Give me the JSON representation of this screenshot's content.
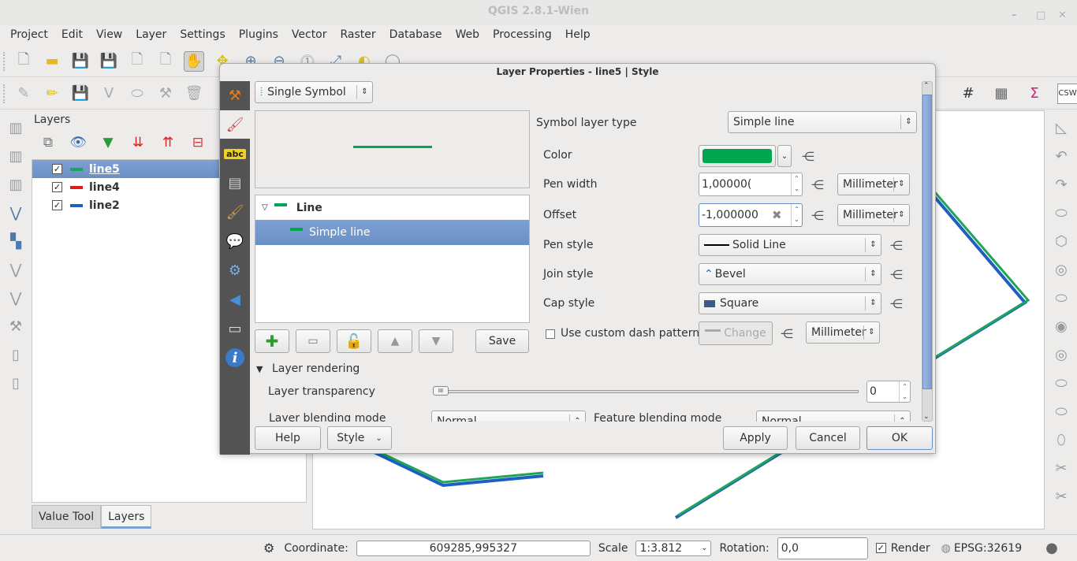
{
  "window": {
    "title": "QGIS 2.8.1-Wien",
    "controls": [
      "minimize",
      "maximize",
      "close"
    ]
  },
  "menubar": [
    "Project",
    "Edit",
    "View",
    "Layer",
    "Settings",
    "Plugins",
    "Vector",
    "Raster",
    "Database",
    "Web",
    "Processing",
    "Help"
  ],
  "toolbar1": [
    "new-project-icon",
    "open-project-icon",
    "save-project-icon",
    "save-as-icon",
    "new-composer-icon",
    "composer-manager-icon",
    "pan-icon",
    "pan-to-selection-icon",
    "zoom-in-icon",
    "zoom-out-icon",
    "zoom-native-icon",
    "zoom-full-icon",
    "zoom-to-selection-icon",
    "zoom-to-layer-icon",
    "zoom-last-icon",
    "zoom-next-icon",
    "refresh-icon"
  ],
  "toolbar2": [
    "current-edits-icon",
    "toggle-editing-icon",
    "save-edits-icon",
    "node-tool-icon",
    "move-feature-icon",
    "digitize-icon",
    "delete-selected-icon"
  ],
  "layers_panel": {
    "title": "Layers",
    "layers": [
      {
        "name": "line5",
        "checked": true,
        "color": "#1fa55a",
        "selected": true
      },
      {
        "name": "line4",
        "checked": true,
        "color": "#e31a1c",
        "selected": false
      },
      {
        "name": "line2",
        "checked": true,
        "color": "#1f5fbf",
        "selected": false
      }
    ],
    "tabs": [
      {
        "label": "Value Tool",
        "active": false
      },
      {
        "label": "Layers",
        "active": true
      }
    ]
  },
  "dialog": {
    "title": "Layer Properties - line5 | Style",
    "renderer": "Single Symbol",
    "sidebar": [
      "general-icon",
      "style-icon",
      "labels-icon",
      "fields-icon",
      "rendering-icon",
      "display-icon",
      "actions-icon",
      "joins-icon",
      "diagrams-icon",
      "metadata-icon"
    ],
    "tree": {
      "root": "Line",
      "child": "Simple line"
    },
    "save_label": "Save",
    "symbol_layer_type_label": "Symbol layer type",
    "symbol_layer_type": "Simple line",
    "color_label": "Color",
    "color_value": "#00a54f",
    "pen_width_label": "Pen width",
    "pen_width": "1,00000(",
    "pen_width_unit": "Millimeter",
    "offset_label": "Offset",
    "offset": "-1,000000",
    "offset_unit": "Millimeter",
    "pen_style_label": "Pen style",
    "pen_style": "Solid Line",
    "join_style_label": "Join style",
    "join_style": "Bevel",
    "cap_style_label": "Cap style",
    "cap_style": "Square",
    "custom_dash_label": "Use custom dash pattern",
    "custom_dash_checked": false,
    "change_label": "Change",
    "dash_unit": "Millimeter",
    "layer_rendering_label": "Layer rendering",
    "transparency_label": "Layer transparency",
    "transparency_value": "0",
    "layer_blending_label": "Layer blending mode",
    "layer_blending": "Normal",
    "feature_blending_label": "Feature blending mode",
    "feature_blending": "Normal",
    "help_label": "Help",
    "style_label": "Style",
    "apply_label": "Apply",
    "cancel_label": "Cancel",
    "ok_label": "OK"
  },
  "statusbar": {
    "coordinate_label": "Coordinate:",
    "coordinate": "609285,995327",
    "scale_label": "Scale",
    "scale": "1:3.812",
    "rotation_label": "Rotation:",
    "rotation": "0,0",
    "render_label": "Render",
    "render_checked": true,
    "crs": "EPSG:32619"
  }
}
